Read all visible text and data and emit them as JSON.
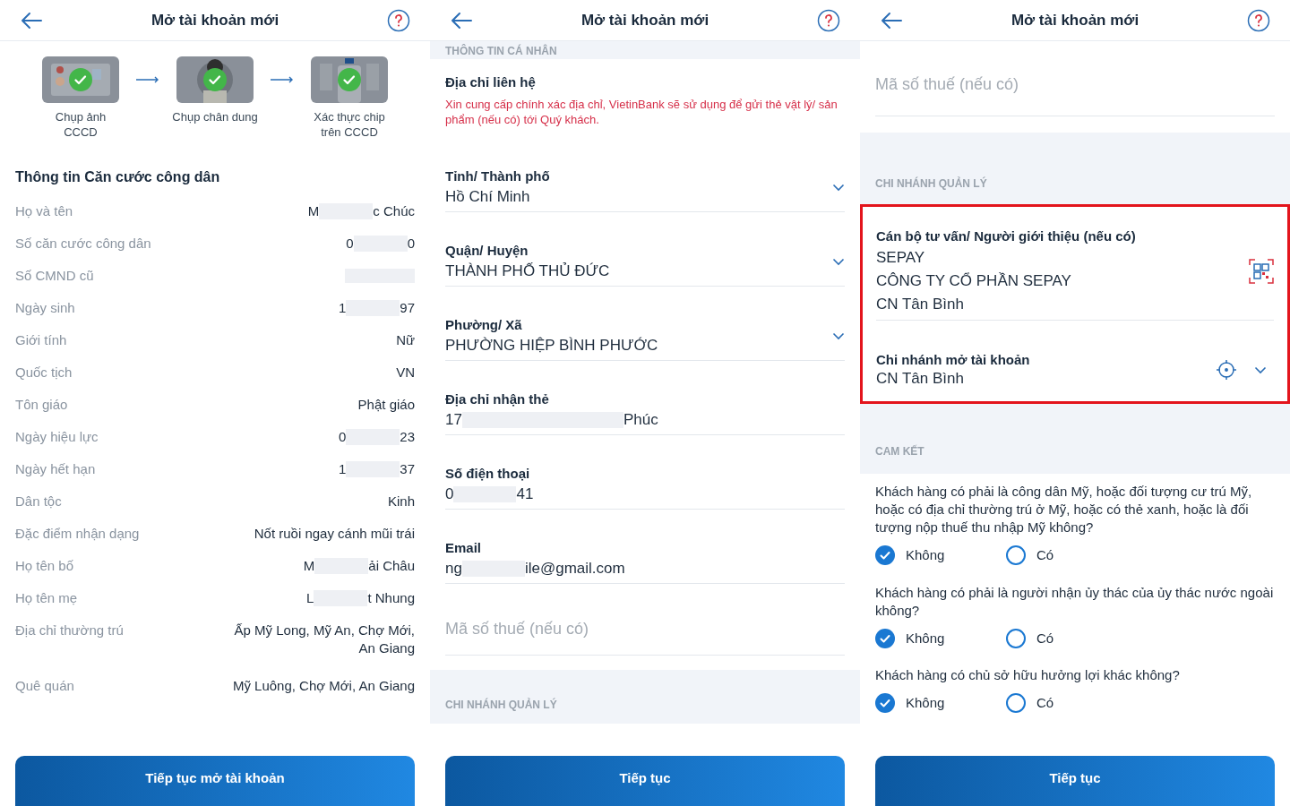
{
  "screen_1": {
    "title": "Mở tài khoản mới",
    "steps": [
      {
        "label": "Chụp ảnh\nCCCD",
        "done": true
      },
      {
        "label": "Chụp chân dung",
        "done": true
      },
      {
        "label": "Xác thực chip\ntrên CCCD",
        "done": true
      }
    ],
    "section_title": "Thông tin Căn cước công dân",
    "rows": [
      {
        "label": "Họ và tên",
        "value_parts": [
          "M",
          "c Chúc"
        ]
      },
      {
        "label": "Số căn cước công dân",
        "value_parts": [
          "0",
          "0"
        ]
      },
      {
        "label": "Số CMND cũ",
        "redacted": true
      },
      {
        "label": "Ngày sinh",
        "value_parts": [
          "1",
          "97"
        ]
      },
      {
        "label": "Giới tính",
        "value": "Nữ"
      },
      {
        "label": "Quốc tịch",
        "value": "VN"
      },
      {
        "label": "Tôn giáo",
        "value": "Phật giáo"
      },
      {
        "label": "Ngày hiệu lực",
        "value_parts": [
          "0",
          "23"
        ]
      },
      {
        "label": "Ngày hết hạn",
        "value_parts": [
          "1",
          "37"
        ]
      },
      {
        "label": "Dân tộc",
        "value": "Kinh"
      },
      {
        "label": "Đặc điểm nhận dạng",
        "value": "Nốt ruồi ngay cánh mũi trái"
      },
      {
        "label": "Họ tên bố",
        "value_parts": [
          "M",
          "ải Châu"
        ]
      },
      {
        "label": "Họ tên mẹ",
        "value_parts": [
          "L",
          "t Nhung"
        ]
      },
      {
        "label": "Địa chỉ thường trú",
        "value": "Ấp Mỹ Long, Mỹ An, Chợ Mới, An Giang"
      },
      {
        "label": "Quê quán",
        "value": "Mỹ Luông, Chợ Mới, An Giang"
      }
    ],
    "button": "Tiếp tục mở tài khoản"
  },
  "screen_2": {
    "title": "Mở tài khoản mới",
    "section_band": "THÔNG TIN CÁ NHÂN",
    "contact_title": "Địa chỉ liên hệ",
    "contact_note": "Xin cung cấp chính xác địa chỉ, VietinBank sẽ sử dụng để gửi thẻ vật lý/ sản phẩm (nếu có) tới Quý khách.",
    "fields": [
      {
        "kind": "select",
        "label": "Tỉnh/ Thành phố",
        "value": "Hồ Chí Minh"
      },
      {
        "kind": "select",
        "label": "Quận/ Huyện",
        "value": "THÀNH PHỐ THỦ ĐỨC"
      },
      {
        "kind": "select",
        "label": "Phường/ Xã",
        "value": "PHƯỜNG HIỆP BÌNH PHƯỚC"
      },
      {
        "kind": "text",
        "label": "Địa chỉ nhận thẻ",
        "value_parts": [
          "17",
          "Phúc"
        ]
      },
      {
        "kind": "text",
        "label": "Số điện thoại",
        "value_parts": [
          "0",
          "41"
        ]
      },
      {
        "kind": "text",
        "label": "Email",
        "value_parts": [
          "ng",
          "ile@gmail.com"
        ]
      },
      {
        "kind": "input",
        "placeholder": "Mã số thuế (nếu có)"
      }
    ],
    "branch_band": "CHI NHÁNH QUẢN LÝ",
    "button": "Tiếp tục"
  },
  "screen_3": {
    "title": "Mở tài khoản mới",
    "tax_field": {
      "placeholder": "Mã số thuế (nếu có)"
    },
    "branch_band": "CHI NHÁNH QUẢN LÝ",
    "highlighted": true,
    "advisor": {
      "label": "Cán bộ tư vấn/ Người giới thiệu (nếu có)",
      "lines": [
        "SEPAY",
        "CÔNG TY CỔ PHẦN SEPAY",
        "CN Tân Bình"
      ]
    },
    "branch": {
      "label": "Chi nhánh mở tài khoản",
      "value": "CN Tân Bình"
    },
    "commit_band": "CAM KẾT",
    "questions": [
      {
        "text": "Khách hàng có phải là công dân Mỹ, hoặc đối tượng cư trú Mỹ, hoặc có địa chỉ thường trú ở Mỹ, hoặc có thẻ xanh, hoặc là đối tượng nộp thuế thu nhập Mỹ không?",
        "options": [
          {
            "label": "Không",
            "selected": true
          },
          {
            "label": "Có",
            "selected": false
          }
        ]
      },
      {
        "text": "Khách hàng có phải là người nhận ủy thác của ủy thác nước ngoài không?",
        "options": [
          {
            "label": "Không",
            "selected": true
          },
          {
            "label": "Có",
            "selected": false
          }
        ]
      },
      {
        "text": "Khách hàng có chủ sở hữu hưởng lợi khác không?",
        "options": [
          {
            "label": "Không",
            "selected": true
          },
          {
            "label": "Có",
            "selected": false
          }
        ]
      }
    ],
    "button": "Tiếp tục"
  }
}
